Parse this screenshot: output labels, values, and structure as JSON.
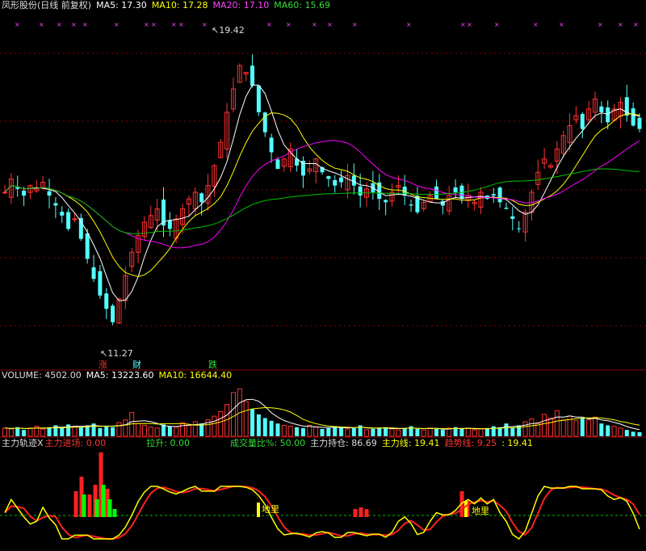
{
  "header": {
    "title": "凤形股份(日线 前复权)",
    "ma5": "MA5: 17.30",
    "ma10": "MA10: 17.28",
    "ma20": "MA20: 17.10",
    "ma60": "MA60: 15.69"
  },
  "volume_header": {
    "label": "VOLUME: 4502.00",
    "ma5": "MA5: 13223.60",
    "ma10": "MA10: 16644.40"
  },
  "indicator_header": {
    "name": "主力轨迹X",
    "entry": "主力进场: 0.00",
    "lift": "拉升: 0.00",
    "vol_ratio": "成交量比%: 50.00",
    "holding": "主力持仓: 86.69",
    "main_line": "主力线: 19.41",
    "trend_line": "趋势线: 9.25",
    "extra": ": 19.41"
  },
  "annotations": {
    "high": "19.42",
    "low": "11.27",
    "zhang": "涨",
    "cai": "财",
    "die": "跌",
    "dili1": "地里",
    "dili2": "地里"
  },
  "colors": {
    "up": "#ff3232",
    "down": "#54ffff",
    "ma5": "#ffffff",
    "ma10": "#ffff00",
    "ma20": "#ff00ff",
    "ma60": "#00c000",
    "grid": "#8b0000"
  },
  "chart_data": [
    {
      "type": "candlestick",
      "title": "凤形股份(日线 前复权)",
      "ylim": [
        10.5,
        20.2
      ],
      "annotated_high": 19.42,
      "annotated_low": 11.27,
      "closes": [
        15.4,
        15.8,
        15.5,
        15.3,
        15.6,
        15.5,
        15.7,
        15.3,
        15.0,
        14.7,
        14.3,
        14.6,
        14.0,
        13.4,
        12.8,
        12.3,
        11.9,
        11.5,
        12.2,
        12.9,
        13.6,
        14.1,
        14.5,
        14.7,
        14.9,
        14.4,
        14.3,
        14.6,
        14.9,
        15.2,
        15.4,
        15.1,
        15.6,
        16.2,
        16.9,
        17.8,
        18.5,
        19.2,
        19.0,
        18.6,
        17.8,
        17.2,
        16.6,
        16.1,
        16.4,
        16.7,
        16.2,
        15.9,
        16.1,
        16.4,
        16.0,
        15.8,
        15.6,
        15.7,
        15.9,
        15.6,
        15.3,
        15.5,
        15.4,
        15.2,
        15.1,
        15.4,
        15.6,
        15.3,
        15.0,
        14.8,
        15.1,
        15.3,
        15.2,
        15.0,
        15.3,
        15.4,
        15.2,
        15.3,
        15.1,
        15.4,
        15.2,
        15.3,
        15.1,
        14.9,
        14.6,
        14.3,
        14.8,
        15.4,
        16.0,
        16.4,
        16.2,
        16.7,
        17.1,
        17.4,
        17.7,
        17.3,
        17.9,
        18.2,
        17.8,
        17.5,
        17.9,
        18.1,
        17.7,
        17.4,
        17.3
      ]
    },
    {
      "type": "bar",
      "title": "VOLUME",
      "ylim": [
        0,
        62000
      ],
      "values": [
        9000,
        8000,
        10000,
        7000,
        9000,
        11000,
        8000,
        10000,
        12000,
        9000,
        13000,
        11000,
        10000,
        12000,
        14000,
        9000,
        11000,
        10000,
        15000,
        18000,
        26000,
        14000,
        12000,
        10000,
        9000,
        13000,
        11000,
        10000,
        15000,
        12000,
        16000,
        14000,
        18000,
        22000,
        27000,
        35000,
        48000,
        52000,
        38000,
        30000,
        24000,
        20000,
        17000,
        14000,
        12000,
        11000,
        10000,
        9000,
        12000,
        10000,
        8000,
        9000,
        11000,
        10000,
        8000,
        9000,
        12000,
        7000,
        8000,
        9000,
        10000,
        8000,
        7000,
        9000,
        11000,
        8000,
        7000,
        9000,
        8000,
        7000,
        9000,
        10000,
        8000,
        9000,
        7000,
        8000,
        9000,
        11000,
        10000,
        14000,
        9000,
        12000,
        16000,
        19000,
        15000,
        24000,
        20000,
        28000,
        18000,
        22000,
        17000,
        20000,
        18000,
        21000,
        14000,
        12000,
        11000,
        9000,
        7000,
        5000,
        4502
      ]
    }
  ]
}
